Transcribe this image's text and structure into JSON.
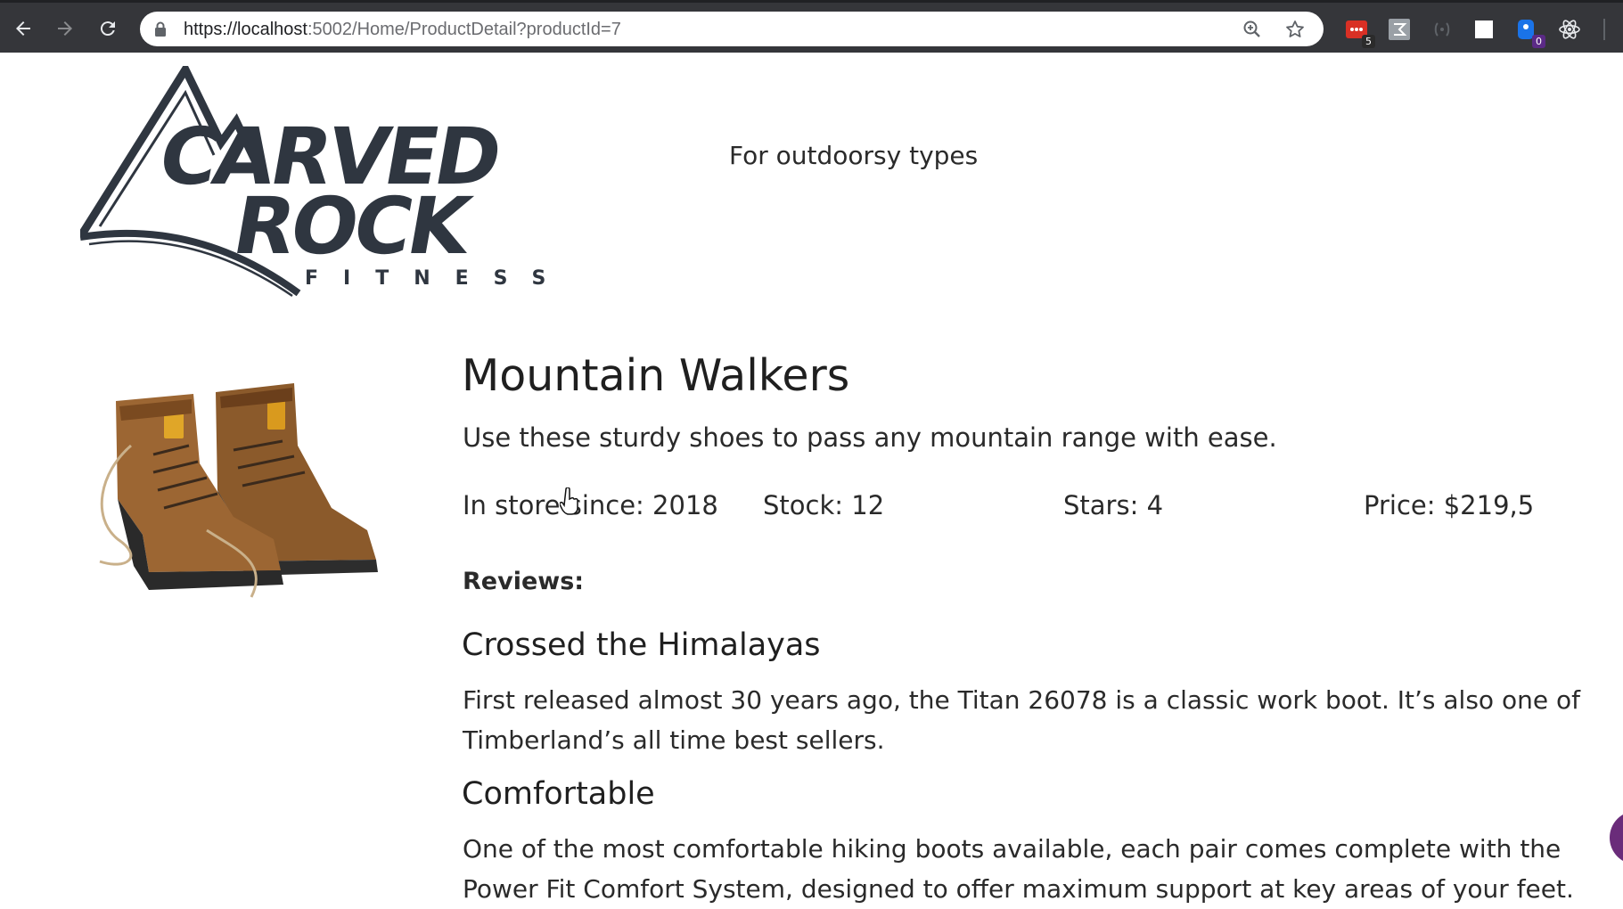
{
  "browser": {
    "url_host": "https://localhost",
    "url_rest": ":5002/Home/ProductDetail?productId=7",
    "extensions": [
      {
        "name": "extension-red",
        "badge": "5"
      },
      {
        "name": "extension-gray"
      },
      {
        "name": "extension-brackets"
      },
      {
        "name": "extension-white"
      },
      {
        "name": "extension-blue",
        "badge": "0"
      },
      {
        "name": "react-devtools"
      }
    ]
  },
  "header": {
    "logo_text": "CARVED ROCK FITNESS",
    "tagline": "For outdoorsy types"
  },
  "product": {
    "name": "Mountain Walkers",
    "description": "Use these sturdy shoes to pass any mountain range with ease.",
    "in_store_since": "In store since: 2018",
    "stock": "Stock: 12",
    "stars": "Stars: 4",
    "price": "Price: $219,5"
  },
  "reviews": {
    "heading": "Reviews:",
    "items": [
      {
        "title": "Crossed the Himalayas",
        "text": "First released almost 30 years ago, the Titan 26078 is a classic work boot. It’s also one of Timberland’s all time best sellers."
      },
      {
        "title": "Comfortable",
        "text": "One of the most comfortable hiking boots available, each pair comes complete with the Power Fit Comfort System, designed to offer maximum support at key areas of your feet."
      }
    ]
  },
  "colors": {
    "chrome_bg": "#35363a",
    "logo": "#2f3640",
    "text": "#2a2a2a"
  }
}
